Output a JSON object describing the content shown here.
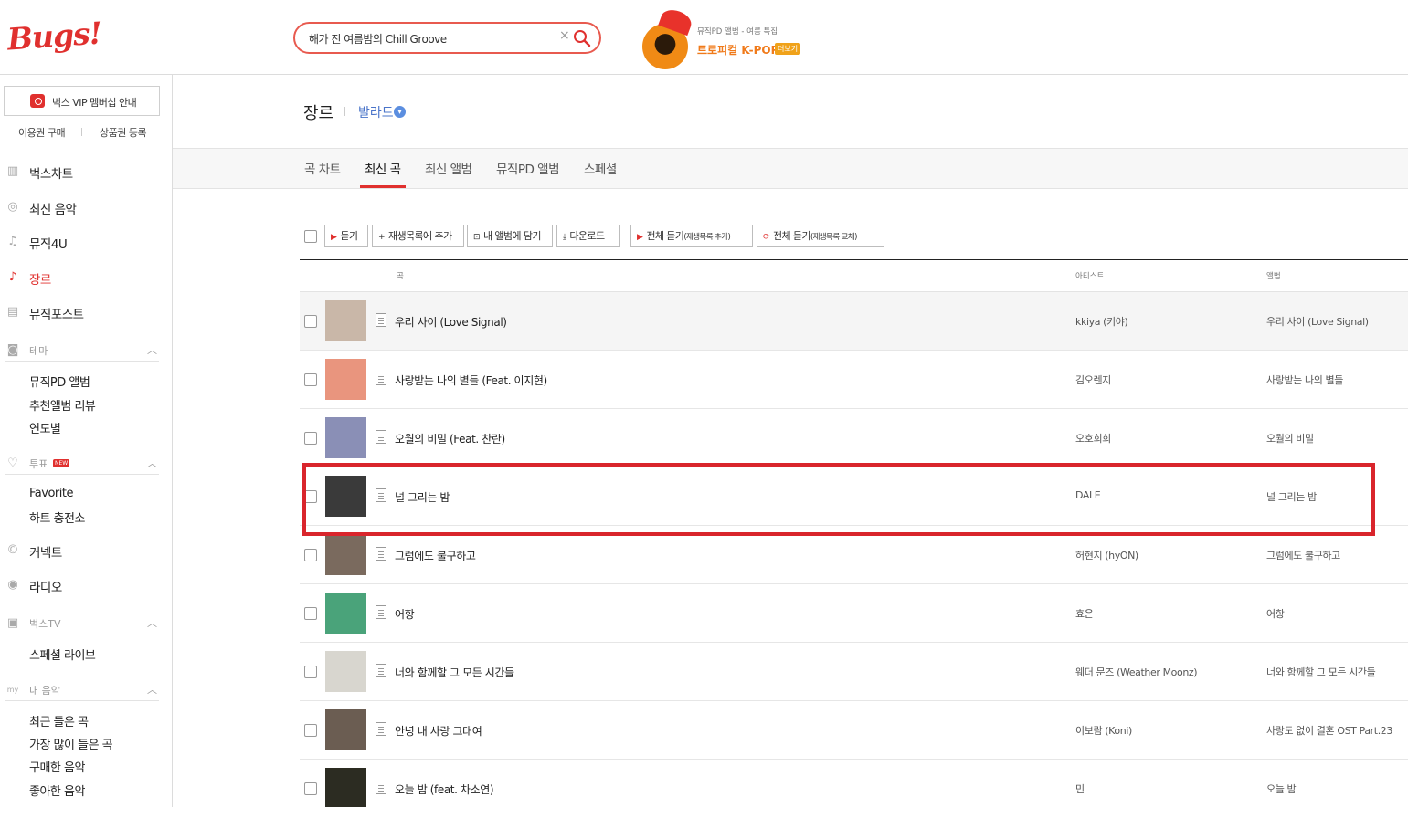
{
  "app": {
    "logo": "Bugs!"
  },
  "search": {
    "value": "해가 진 여름밤의 Chill Groove",
    "clear": "×"
  },
  "promo": {
    "small": "뮤직PD 앨범 - 여름 특집",
    "title": "트로피컬 K-POP",
    "more": "더보기"
  },
  "sidebar": {
    "vip": "벅스 VIP 멤버십 안내",
    "buy": "이용권 구매",
    "register": "상품권 등록",
    "nav": [
      {
        "label": "벅스차트",
        "icon": "chart-icon"
      },
      {
        "label": "최신 음악",
        "icon": "disc-icon"
      },
      {
        "label": "뮤직4U",
        "icon": "music-note-icon"
      },
      {
        "label": "장르",
        "icon": "guitar-icon"
      },
      {
        "label": "뮤직포스트",
        "icon": "post-icon"
      }
    ],
    "theme": {
      "label": "테마",
      "items": [
        "뮤직PD 앨범",
        "추천앨범 리뷰",
        "연도별"
      ]
    },
    "vote": {
      "label": "투표",
      "badge": "NEW",
      "items": [
        "Favorite",
        "하트 충전소"
      ]
    },
    "connect": "커넥트",
    "radio": "라디오",
    "bugstv": {
      "label": "벅스TV",
      "items": [
        "스페셜 라이브"
      ]
    },
    "mymusic": {
      "label": "내 음악",
      "items": [
        "최근 들은 곡",
        "가장 많이 들은 곡",
        "구매한 음악",
        "좋아한 음악"
      ]
    }
  },
  "genre": {
    "title": "장르",
    "selected": "발라드"
  },
  "tabs": [
    "곡 차트",
    "최신 곡",
    "최신 앨범",
    "뮤직PD 앨범",
    "스페셜"
  ],
  "toolbar": {
    "listen": "듣기",
    "add": "재생목록에 추가",
    "save": "내 앨범에 담기",
    "download": "다운로드",
    "listen_all": "전체 듣기",
    "listen_all_note": "(재생목록 추가)",
    "replace_all": "전체 듣기",
    "replace_all_note": "(재생목록 교체)"
  },
  "table": {
    "headers": {
      "song": "곡",
      "artist": "아티스트",
      "album": "앨범"
    },
    "rows": [
      {
        "title": "우리 사이 (Love Signal)",
        "artist": "kkiya (키야)",
        "album": "우리 사이 (Love Signal)",
        "thumb": "#c9b7a8"
      },
      {
        "title": "사랑받는 나의 별들 (Feat. 이지현)",
        "artist": "김오렌지",
        "album": "사랑받는 나의 별들",
        "thumb": "#e9957e"
      },
      {
        "title": "오월의 비밀 (Feat. 찬란)",
        "artist": "오호희희",
        "album": "오월의 비밀",
        "thumb": "#8a8fb6"
      },
      {
        "title": "널 그리는 밤",
        "artist": "DALE",
        "album": "널 그리는 밤",
        "thumb": "#3a3a3a"
      },
      {
        "title": "그럼에도 불구하고",
        "artist": "허현지 (hyON)",
        "album": "그럼에도 불구하고",
        "thumb": "#7a6a5e"
      },
      {
        "title": "어항",
        "artist": "효은",
        "album": "어항",
        "thumb": "#4aa37a"
      },
      {
        "title": "너와 함께할 그 모든 시간들",
        "artist": "웨더 문즈 (Weather Moonz)",
        "album": "너와 함께할 그 모든 시간들",
        "thumb": "#d8d6cf"
      },
      {
        "title": "안녕 내 사랑 그대여",
        "artist": "이보람 (Koni)",
        "album": "사랑도 없이 결혼 OST Part.23",
        "thumb": "#6b5d52"
      },
      {
        "title": "오늘 밤 (feat. 차소연)",
        "artist": "민",
        "album": "오늘 밤",
        "thumb": "#2c2c22"
      }
    ]
  }
}
